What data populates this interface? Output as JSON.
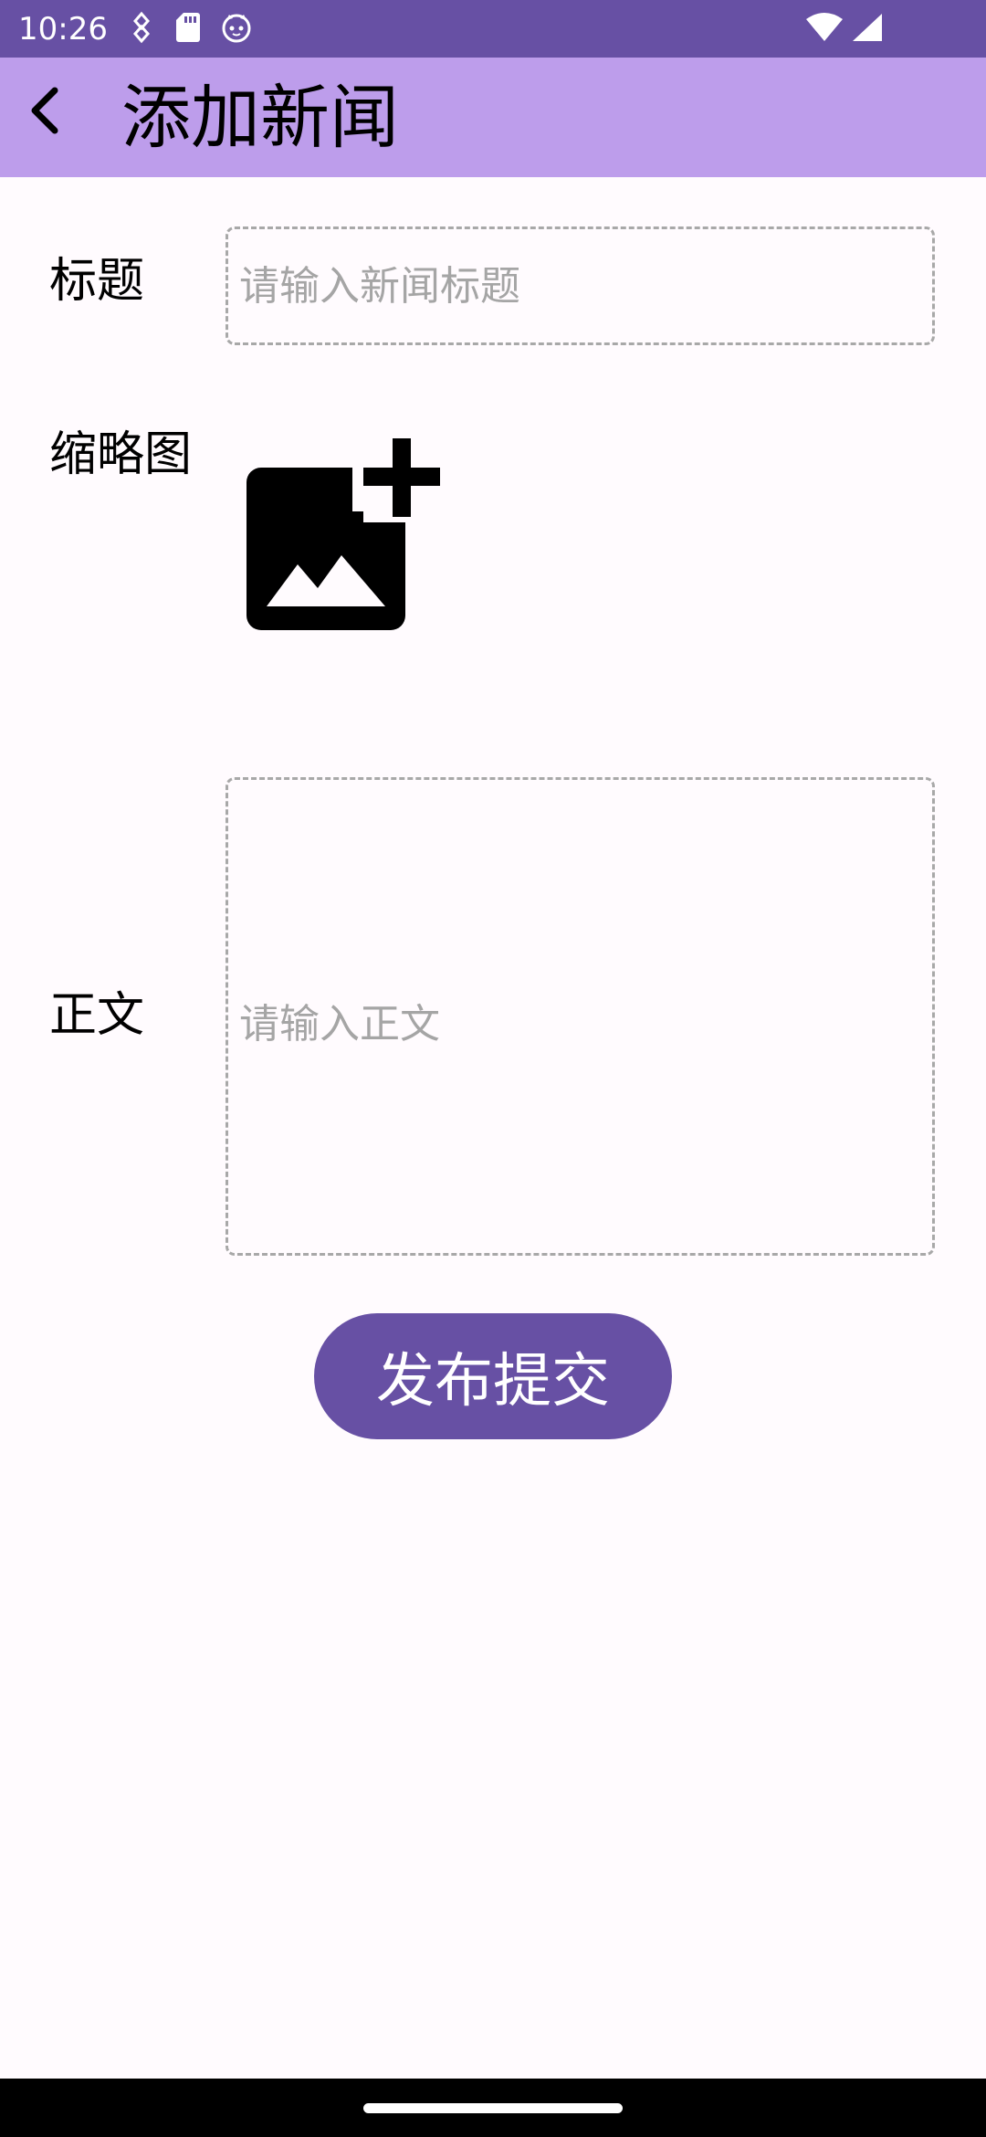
{
  "status_bar": {
    "time": "10:26",
    "left_icons": [
      "data-saver-icon",
      "sd-card-icon",
      "cat-face-icon"
    ],
    "right_icons": [
      "wifi-icon",
      "cellular-signal-icon"
    ]
  },
  "app_bar": {
    "title": "添加新闻",
    "back_icon": "arrow-back-icon"
  },
  "form": {
    "title_label": "标题",
    "title_placeholder": "请输入新闻标题",
    "thumbnail_label": "缩略图",
    "thumbnail_icon": "add-photo-icon",
    "body_label": "正文",
    "body_placeholder": "请输入正文"
  },
  "submit": {
    "label": "发布提交"
  },
  "colors": {
    "status_bar": "#6750a4",
    "app_bar": "#bd9deb",
    "background": "#fffbfe",
    "submit_button": "#6750a4",
    "input_border": "#a8a8a8"
  }
}
